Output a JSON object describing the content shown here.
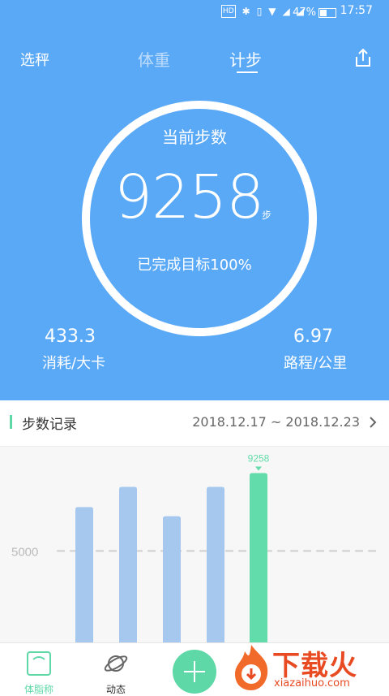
{
  "status_bar": {
    "battery": "47%",
    "time": "17:57",
    "icons": [
      "hd-icon",
      "bluetooth-icon",
      "vibrate-icon",
      "wifi-icon",
      "signal-icon",
      "signal-icon-2"
    ]
  },
  "header": {
    "left_label": "选秤",
    "tabs": [
      {
        "label": "体重",
        "active": false
      },
      {
        "label": "计步",
        "active": true
      }
    ],
    "share_icon": "share-icon"
  },
  "summary": {
    "title": "当前步数",
    "steps": "9258",
    "unit": "步",
    "goal_text": "已完成目标100%",
    "calories_value": "433.3",
    "calories_label": "消耗/大卡",
    "distance_value": "6.97",
    "distance_label": "路程/公里"
  },
  "record": {
    "title": "步数记录",
    "date_range": "2018.12.17 ~ 2018.12.23"
  },
  "chart_data": {
    "type": "bar",
    "values": [
      7400,
      8500,
      6900,
      8500,
      9258
    ],
    "highlight_index": 4,
    "highlight_label": "9258",
    "reference_line": {
      "value": 5000,
      "label": "5000"
    },
    "ylim": [
      0,
      10700
    ],
    "colors": {
      "normal": "#a6c8ef",
      "highlight": "#62dcaa",
      "reference": "#cfcfcf"
    }
  },
  "tabbar": {
    "items": [
      {
        "label": "体脂称",
        "icon": "scale-icon",
        "active": true
      },
      {
        "label": "动态",
        "icon": "planet-icon",
        "active": false
      }
    ],
    "add_icon": "plus-icon"
  },
  "watermark": {
    "main": "下载火",
    "sub": "xiazaihuo.com"
  },
  "colors": {
    "primary_blue": "#5aa9f7",
    "accent_green": "#5fd8a8",
    "watermark": "#e84a22"
  }
}
